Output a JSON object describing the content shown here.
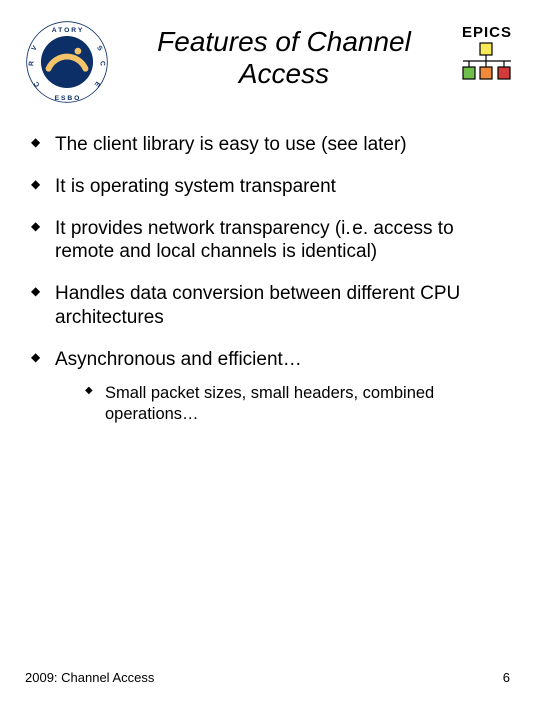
{
  "header": {
    "title": "Features of Channel Access",
    "epics_label": "EPICS"
  },
  "bullets": [
    {
      "text": "The client library is easy to use (see later)"
    },
    {
      "text": "It is operating system transparent"
    },
    {
      "text": "It provides network  transparency (i. e. access to remote and local channels is identical)"
    },
    {
      "text": "Handles data conversion between different CPU architectures"
    },
    {
      "text": "Asynchronous and efficient…",
      "sub": [
        {
          "text": "Small packet sizes, small headers, combined operations…"
        }
      ]
    }
  ],
  "footer": {
    "left": "2009: Channel Access",
    "right": "6"
  }
}
